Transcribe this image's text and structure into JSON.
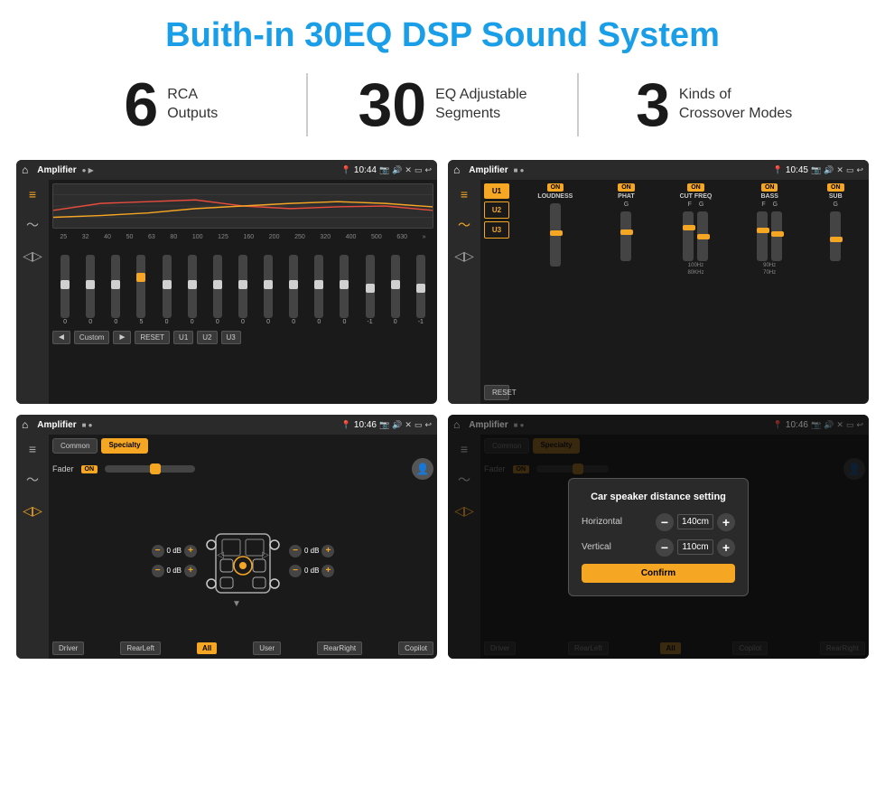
{
  "page": {
    "title": "Buith-in 30EQ DSP Sound System",
    "background": "#ffffff"
  },
  "stats": [
    {
      "number": "6",
      "label": "RCA\nOutputs"
    },
    {
      "number": "30",
      "label": "EQ Adjustable\nSegments"
    },
    {
      "number": "3",
      "label": "Kinds of\nCrossover Modes"
    }
  ],
  "screens": {
    "screen1": {
      "title": "Amplifier",
      "time": "10:44",
      "eq_freqs": [
        "25",
        "32",
        "40",
        "50",
        "63",
        "80",
        "100",
        "125",
        "160",
        "200",
        "250",
        "320",
        "400",
        "500",
        "630"
      ],
      "eq_values": [
        "0",
        "0",
        "0",
        "5",
        "0",
        "0",
        "0",
        "0",
        "0",
        "0",
        "0",
        "0",
        "-1",
        "0",
        "-1"
      ],
      "preset": "Custom",
      "buttons": [
        "◄",
        "Custom",
        "►",
        "RESET",
        "U1",
        "U2",
        "U3"
      ]
    },
    "screen2": {
      "title": "Amplifier",
      "time": "10:45",
      "u_buttons": [
        "U1",
        "U2",
        "U3"
      ],
      "controls": [
        "LOUDNESS",
        "PHAT",
        "CUT FREQ",
        "BASS",
        "SUB"
      ],
      "reset_label": "RESET"
    },
    "screen3": {
      "title": "Amplifier",
      "time": "10:46",
      "tabs": [
        "Common",
        "Specialty"
      ],
      "active_tab": "Specialty",
      "fader_label": "Fader",
      "fader_on": "ON",
      "db_values": [
        "0 dB",
        "0 dB",
        "0 dB",
        "0 dB"
      ],
      "bottom_buttons": [
        "Driver",
        "RearLeft",
        "All",
        "User",
        "RearRight",
        "Copilot"
      ]
    },
    "screen4": {
      "title": "Amplifier",
      "time": "10:46",
      "tabs": [
        "Common",
        "Specialty"
      ],
      "dialog": {
        "title": "Car speaker distance setting",
        "horizontal_label": "Horizontal",
        "horizontal_value": "140cm",
        "vertical_label": "Vertical",
        "vertical_value": "110cm",
        "confirm_label": "Confirm"
      },
      "bottom_buttons": [
        "Driver",
        "RearLeft",
        "All",
        "Copilot",
        "RearRight"
      ]
    }
  }
}
